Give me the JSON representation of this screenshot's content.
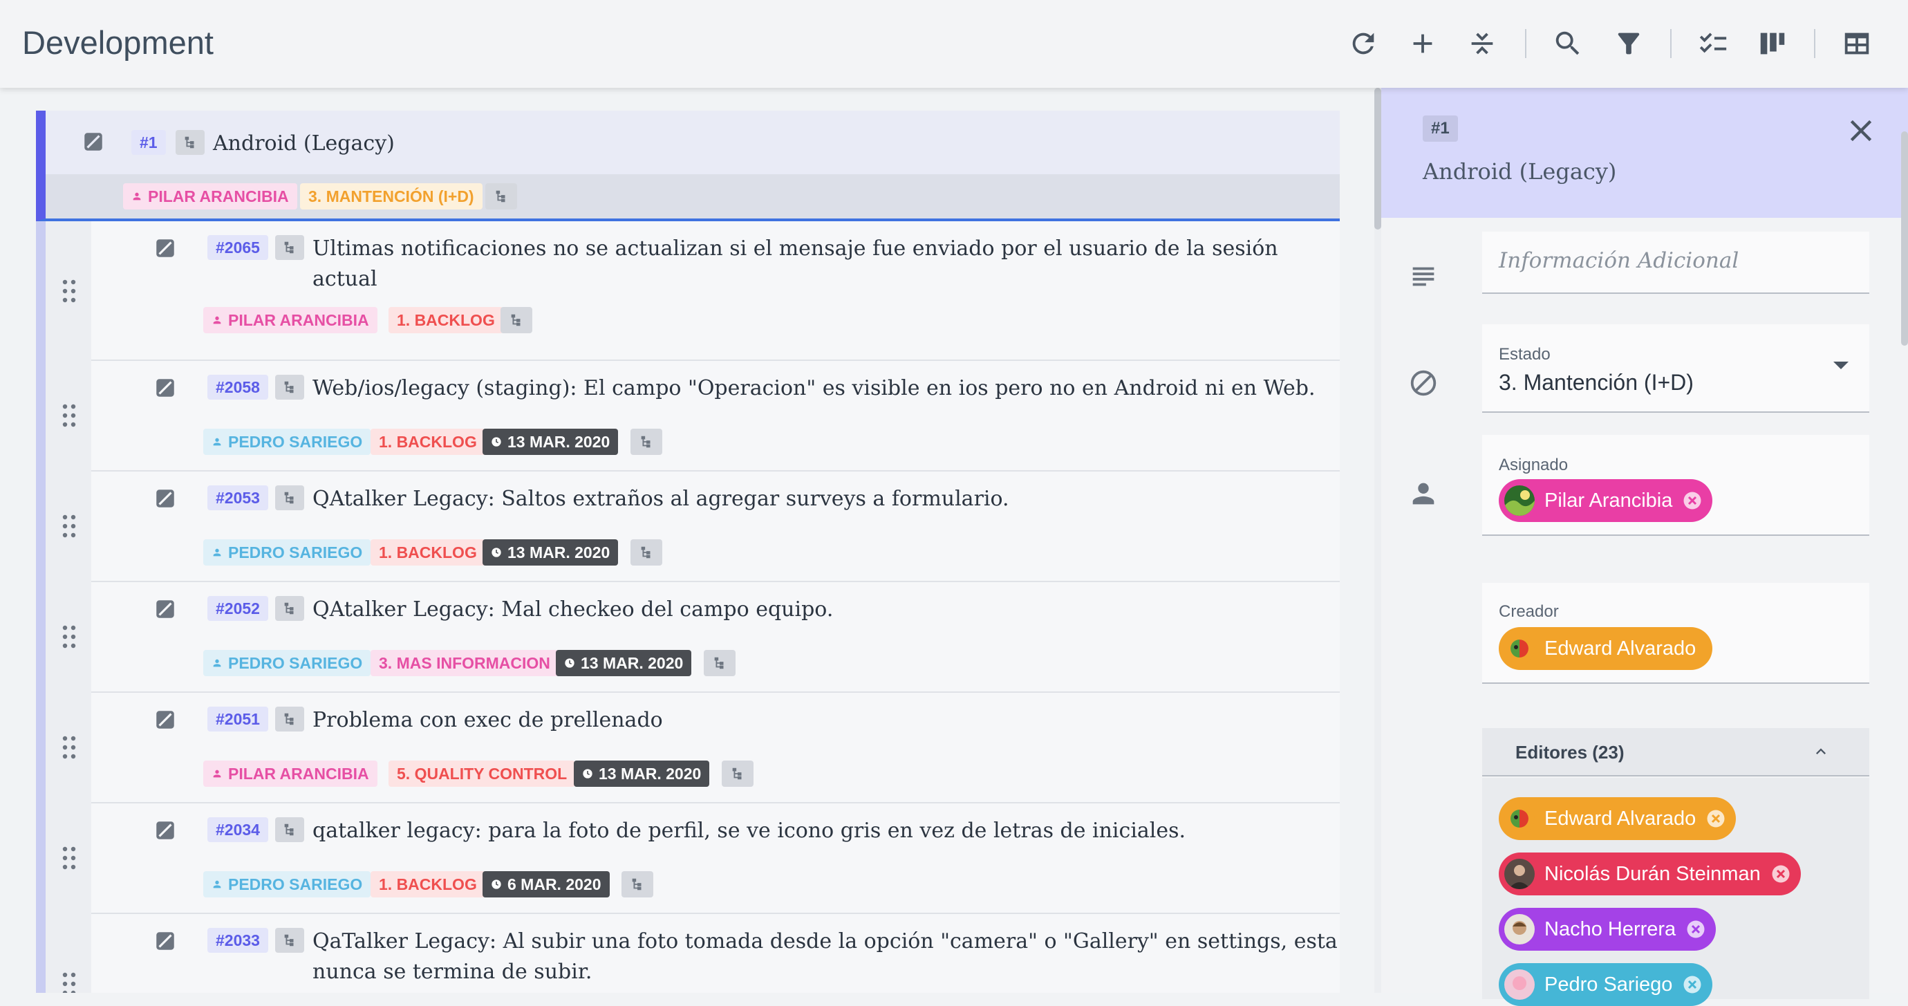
{
  "app": {
    "title": "Development"
  },
  "toolbar": {
    "icons": [
      "refresh-icon",
      "add-icon",
      "collapse-icon",
      "search-icon",
      "filter-icon",
      "checklist-icon",
      "board-icon",
      "table-icon"
    ]
  },
  "parent": {
    "id": "#1",
    "title": "Android (Legacy)",
    "assignee": "PILAR ARANCIBIA",
    "status": "3. MANTENCIÓN (I+D)"
  },
  "items": [
    {
      "id": "#2065",
      "title_line1": "Ultimas notificaciones no se actualizan si el mensaje fue enviado por el usuario de la sesión",
      "title_line2": "actual",
      "assignee": "PILAR ARANCIBIA",
      "status": "1. BACKLOG",
      "date": ""
    },
    {
      "id": "#2058",
      "title_line1": "Web/ios/legacy (staging): El campo \"Operacion\" es visible en ios pero no en Android ni en Web.",
      "title_line2": "",
      "assignee": "PEDRO SARIEGO",
      "status": "1. BACKLOG",
      "date": "13 MAR. 2020"
    },
    {
      "id": "#2053",
      "title_line1": "QAtalker Legacy: Saltos extraños al agregar surveys a formulario.",
      "title_line2": "",
      "assignee": "PEDRO SARIEGO",
      "status": "1. BACKLOG",
      "date": "13 MAR. 2020"
    },
    {
      "id": "#2052",
      "title_line1": "QAtalker Legacy: Mal checkeo del campo equipo.",
      "title_line2": "",
      "assignee": "PEDRO SARIEGO",
      "status": "3. MAS INFORMACION",
      "date": "13 MAR. 2020"
    },
    {
      "id": "#2051",
      "title_line1": "Problema con exec de prellenado",
      "title_line2": "",
      "assignee": "PILAR ARANCIBIA",
      "status": "5. QUALITY CONTROL",
      "date": "13 MAR. 2020"
    },
    {
      "id": "#2034",
      "title_line1": "qatalker legacy: para la foto de perfil, se ve icono gris en vez de letras de iniciales.",
      "title_line2": "",
      "assignee": "PEDRO SARIEGO",
      "status": "1. BACKLOG",
      "date": "6 MAR. 2020"
    },
    {
      "id": "#2033",
      "title_line1": "QaTalker Legacy: Al subir una foto tomada desde la opción \"camera\" o \"Gallery\" en settings, esta",
      "title_line2": "nunca se termina de subir.",
      "assignee": "",
      "status": "",
      "date": ""
    }
  ],
  "detail": {
    "id": "#1",
    "title": "Android (Legacy)",
    "info_placeholder": "Información Adicional",
    "estado_label": "Estado",
    "estado_value": "3. Mantención (I+D)",
    "asignado_label": "Asignado",
    "asignado_name": "Pilar Arancibia",
    "creador_label": "Creador",
    "creador_name": "Edward Alvarado",
    "editors_title": "Editores (23)",
    "editors": [
      "Edward Alvarado",
      "Nicolás Durán Steinman",
      "Nacho Herrera",
      "Pedro Sariego"
    ]
  },
  "colors": {
    "accent": "#5b5ce8",
    "pink": "#e93ea5",
    "orange": "#f2a32a",
    "red": "#e7385a",
    "purple": "#a442e7",
    "teal": "#45b6d6"
  }
}
